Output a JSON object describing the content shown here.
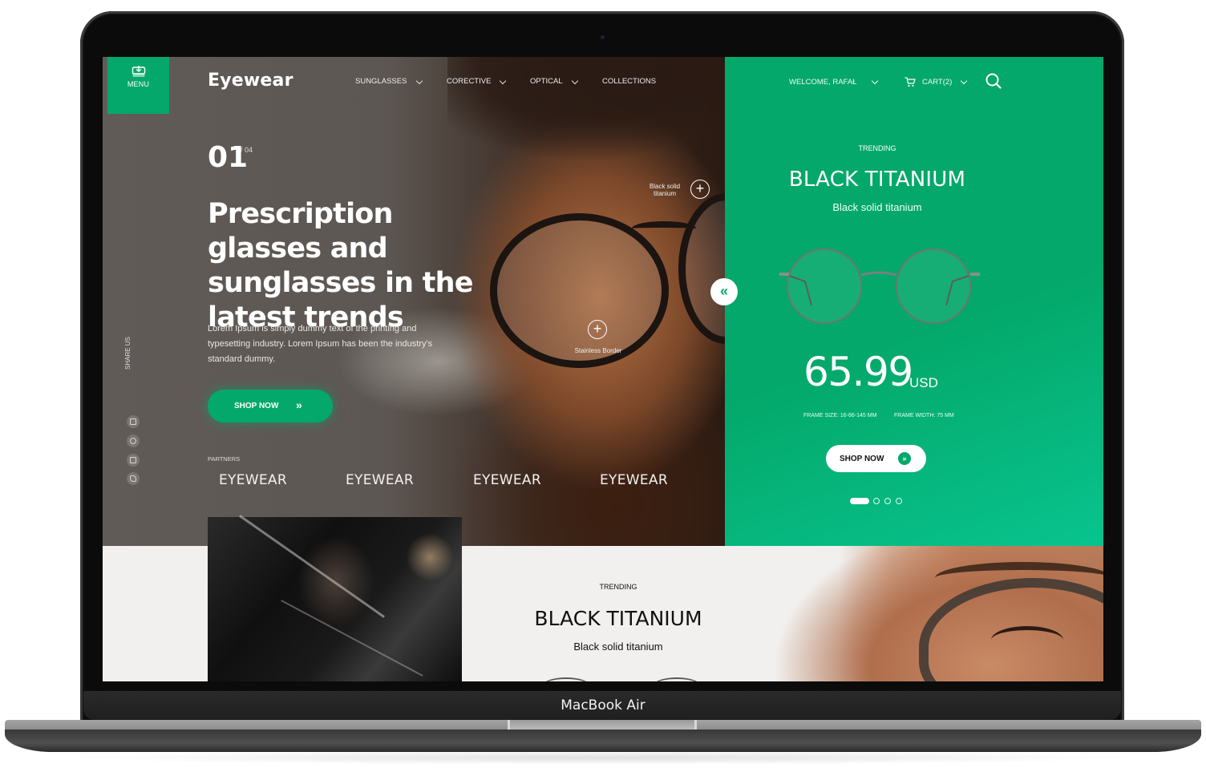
{
  "device": {
    "label": "MacBook Air"
  },
  "colors": {
    "brand_green": "#04a86a",
    "hero_dark": "#5d5753",
    "light_bg": "#f1f0ee"
  },
  "header": {
    "menu": {
      "icon": "download-box-icon",
      "label": "MENU"
    },
    "logo": "Eyewear",
    "nav": [
      {
        "label": "SUNGLASSES",
        "has_dropdown": true
      },
      {
        "label": "CORECTIVE",
        "has_dropdown": true
      },
      {
        "label": "OPTICAL",
        "has_dropdown": true
      },
      {
        "label": "COLLECTIONS",
        "has_dropdown": false
      }
    ],
    "user": {
      "label": "WELCOME, RAFAŁ",
      "has_dropdown": true
    },
    "cart": {
      "icon": "cart-icon",
      "label": "CART(2)",
      "has_dropdown": true
    },
    "search": {
      "icon": "search-icon"
    }
  },
  "hero": {
    "slide_current": "01",
    "slide_total": "/ 04",
    "headline": "Prescription glasses and sunglasses in the latest trends",
    "description": "Lorem Ipsum is simply dummy text of the printing and typesetting industry. Lorem Ipsum has been the industry's standard dummy.",
    "cta": {
      "label": "SHOP NOW",
      "icon": "double-chevron-right-icon"
    },
    "share_label": "SHARE US",
    "social_icons": [
      "youtube-icon",
      "messenger-icon",
      "instagram-icon",
      "twitter-icon"
    ],
    "partners_label": "PARTNERS",
    "partners": [
      "EYEWEAR",
      "EYEWEAR",
      "EYEWEAR",
      "EYEWEAR"
    ],
    "hotspots": [
      {
        "label": "Black solid titanium",
        "icon": "plus-icon"
      },
      {
        "label": "Stainless Border",
        "icon": "plus-icon"
      }
    ],
    "prev_icon": "double-chevron-left-icon"
  },
  "featured": {
    "tag": "TRENDING",
    "title": "BLACK TITANIUM",
    "subtitle": "Black solid titanium",
    "price": "65.99",
    "currency": "USD",
    "frame_size": "FRAME SIZE: 16-66-145 MM",
    "frame_width": "FRAME WIDTH: 75 MM",
    "cta": {
      "label": "SHOP NOW",
      "icon": "double-chevron-right-icon"
    },
    "carousel": {
      "total": 4,
      "active_index": 0
    }
  },
  "lower": {
    "tag": "TRENDING",
    "title": "BLACK TITANIUM",
    "subtitle": "Black solid titanium"
  }
}
